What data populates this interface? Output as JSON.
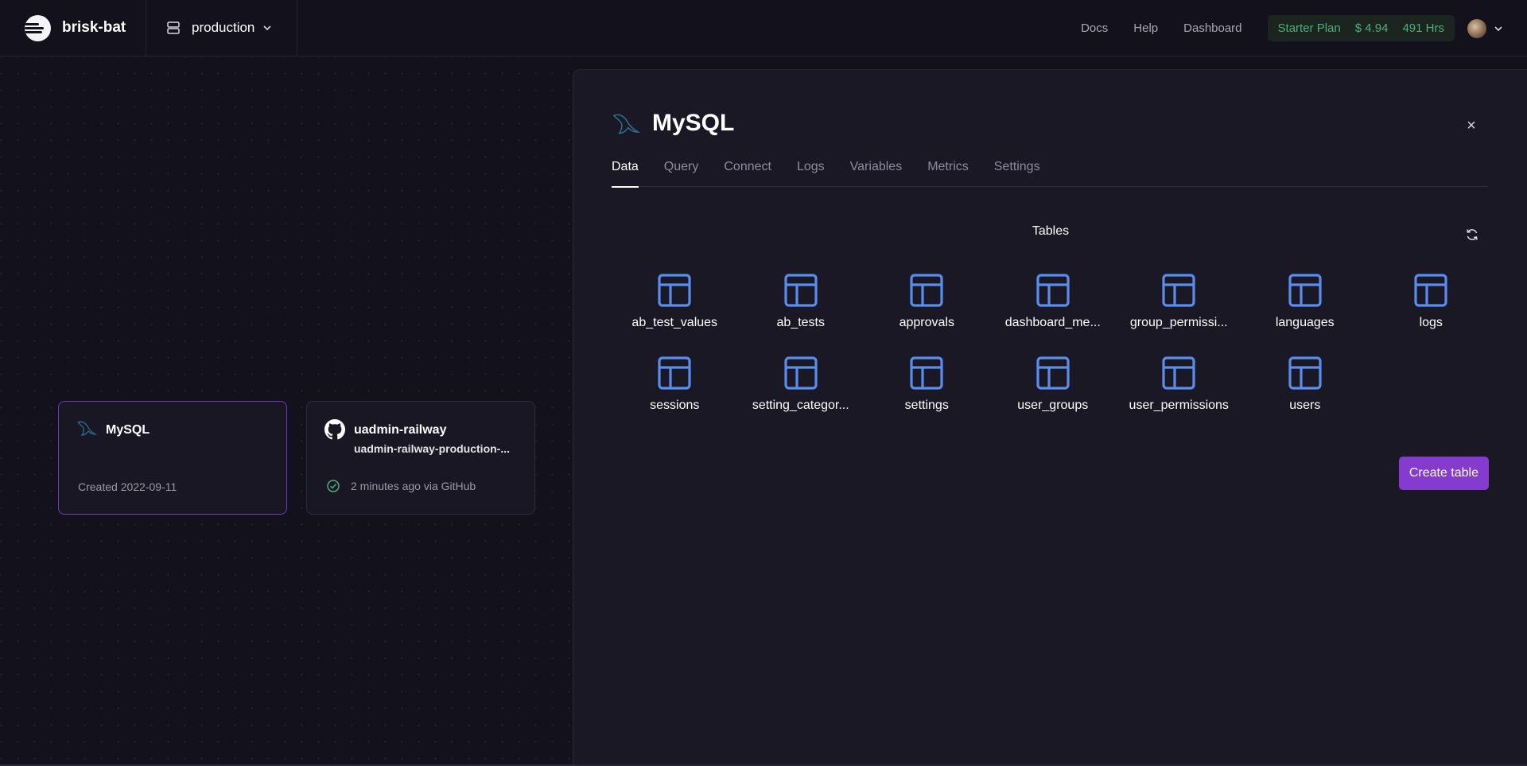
{
  "topbar": {
    "project_name": "brisk-bat",
    "environment": "production",
    "links": [
      "Docs",
      "Help",
      "Dashboard"
    ],
    "plan": {
      "name": "Starter Plan",
      "cost": "$ 4.94",
      "hours": "491 Hrs",
      "color": "#4caf7a"
    }
  },
  "canvas": {
    "cards": [
      {
        "title": "MySQL",
        "subtitle": "",
        "footer": "Created 2022-09-11",
        "icon": "mysql-dolphin-icon"
      },
      {
        "title": "uadmin-railway",
        "subtitle": "uadmin-railway-production-...",
        "footer": "2 minutes ago via GitHub",
        "icon": "github-icon"
      }
    ]
  },
  "panel": {
    "title": "MySQL",
    "close_label": "×",
    "tabs": [
      "Data",
      "Query",
      "Connect",
      "Logs",
      "Variables",
      "Metrics",
      "Settings"
    ],
    "active_tab": "Data",
    "section_title": "Tables",
    "tables": [
      "ab_test_values",
      "ab_tests",
      "approvals",
      "dashboard_me...",
      "group_permissi...",
      "languages",
      "logs",
      "sessions",
      "setting_categor...",
      "settings",
      "user_groups",
      "user_permissions",
      "users"
    ],
    "create_button": "Create table",
    "accent": "#853bce",
    "icon_color": "#5b8def"
  }
}
